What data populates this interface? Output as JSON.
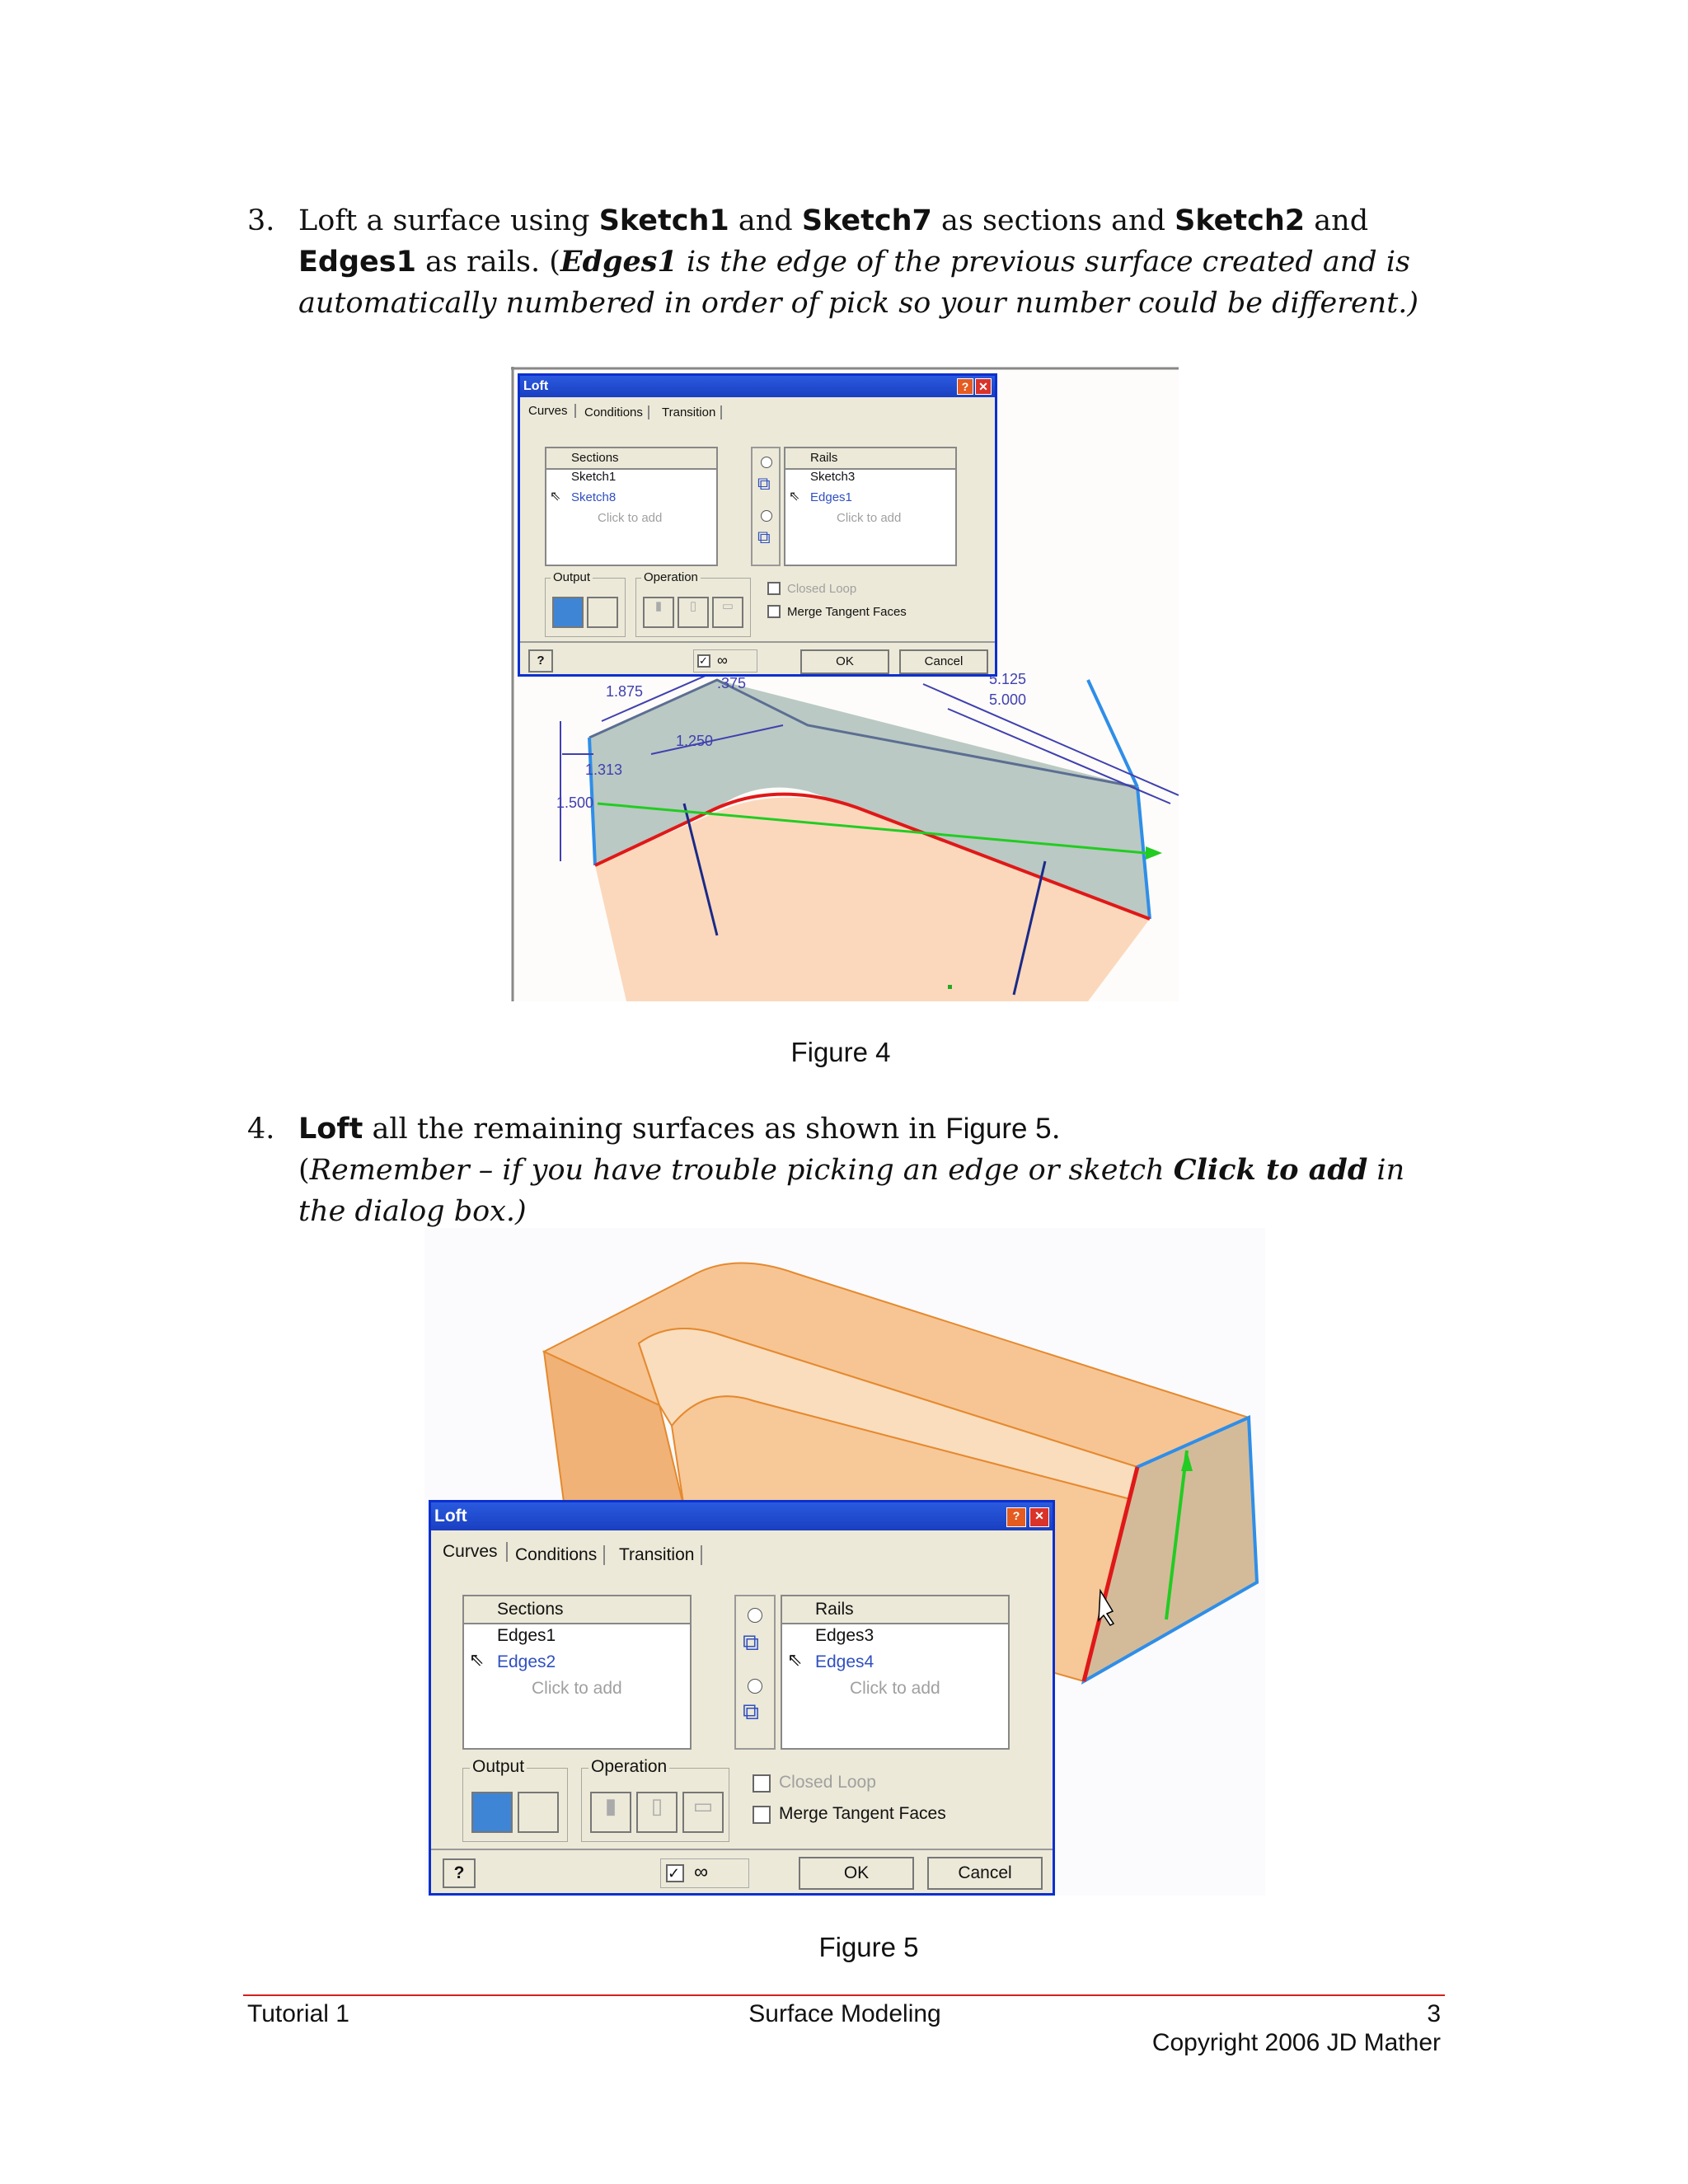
{
  "step3": {
    "num": "3.",
    "t1": "Loft a surface using ",
    "b1": "Sketch1",
    "t2": " and ",
    "b2": "Sketch7",
    "t3": " as sections and ",
    "b3": "Sketch2",
    "t4": " and ",
    "b4": "Edges1",
    "t5": " as rails.  (",
    "ib": "Edges1",
    "it": " is the edge of the previous surface created and is automatically numbered in order of pick so your number could be different.)"
  },
  "figure4": {
    "caption": "Figure 4",
    "dialog": {
      "title": "Loft",
      "tabs": [
        "Curves",
        "Conditions",
        "Transition"
      ],
      "sections_header": "Sections",
      "sections": [
        "Sketch1",
        "Sketch8"
      ],
      "click_to_add": "Click to add",
      "rails_header": "Rails",
      "rails": [
        "Sketch3",
        "Edges1"
      ],
      "output_label": "Output",
      "operation_label": "Operation",
      "closed_loop": "Closed Loop",
      "merge_tangent": "Merge Tangent Faces",
      "ok": "OK",
      "cancel": "Cancel",
      "help": "?"
    },
    "dims": [
      "1.875",
      ".375",
      "1.250",
      "1.313",
      "1.500",
      "5.125",
      "5.000"
    ]
  },
  "step4": {
    "num": "4.",
    "b1": "Loft",
    "t1": " all the remaining surfaces as shown in ",
    "ref": "Figure 5",
    "t2": ".",
    "p_open": "(",
    "i1": "Remember – if you have trouble picking an edge or sketch ",
    "ib": "Click to add",
    "i2": " in the dialog box.)"
  },
  "figure5": {
    "caption": "Figure 5",
    "dialog": {
      "title": "Loft",
      "tabs": [
        "Curves",
        "Conditions",
        "Transition"
      ],
      "sections_header": "Sections",
      "sections": [
        "Edges1",
        "Edges2"
      ],
      "click_to_add": "Click to add",
      "rails_header": "Rails",
      "rails": [
        "Edges3",
        "Edges4"
      ],
      "output_label": "Output",
      "operation_label": "Operation",
      "closed_loop": "Closed Loop",
      "merge_tangent": "Merge Tangent Faces",
      "ok": "OK",
      "cancel": "Cancel",
      "help": "?"
    }
  },
  "footer": {
    "left": "Tutorial 1",
    "center": "Surface Modeling",
    "page": "3",
    "copyright": "Copyright 2006 JD Mather"
  },
  "colors": {
    "footer_rule": "#d42020",
    "dialog_border": "#0a2fd0",
    "dialog_bg": "#ece9d8",
    "surface_peach": "#fbd8bc",
    "surface_orange": "#f0b276",
    "edge_blue": "#2f8ee8",
    "edge_red": "#e01818",
    "rail_green": "#22cc22"
  }
}
